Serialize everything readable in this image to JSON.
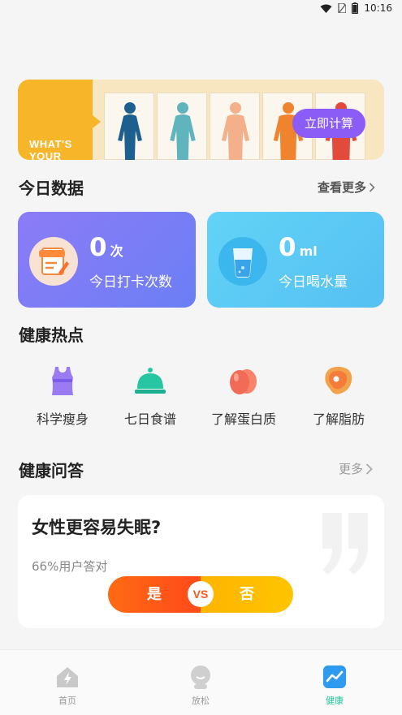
{
  "status_bar": {
    "time": "10:16",
    "icons": [
      "wifi-icon",
      "sim-icon",
      "battery-icon"
    ]
  },
  "banner": {
    "text_line1": "WHAT'S",
    "text_line2": "YOUR",
    "button_label": "立即计算",
    "figure_colors": [
      "#1d5f8f",
      "#5fb4bd",
      "#f3b08a",
      "#f0842e",
      "#e24b3c"
    ]
  },
  "today": {
    "title": "今日数据",
    "more_label": "查看更多",
    "checkin": {
      "value": "0",
      "unit": "次",
      "label": "今日打卡次数",
      "icon": "checklist-icon"
    },
    "water": {
      "value": "0",
      "unit": "ml",
      "label": "今日喝水量",
      "icon": "water-glass-icon"
    }
  },
  "hot": {
    "title": "健康热点",
    "items": [
      {
        "label": "科学瘦身",
        "icon": "tank-top-icon"
      },
      {
        "label": "七日食谱",
        "icon": "food-cloche-icon"
      },
      {
        "label": "了解蛋白质",
        "icon": "eggs-icon"
      },
      {
        "label": "了解脂肪",
        "icon": "meat-icon"
      }
    ]
  },
  "qa": {
    "title": "健康问答",
    "more_label": "更多",
    "question": "女性更容易失眠?",
    "stat": "66%用户答对",
    "yes_label": "是",
    "vs_label": "VS",
    "no_label": "否"
  },
  "nav": {
    "items": [
      {
        "label": "首页",
        "icon": "home-icon",
        "active": false
      },
      {
        "label": "放松",
        "icon": "relax-icon",
        "active": false
      },
      {
        "label": "健康",
        "icon": "health-chart-icon",
        "active": true
      }
    ]
  },
  "colors": {
    "accent_green": "#1fc39b",
    "banner_button": "#8b5cf6",
    "card_purple": "#7b7df5",
    "card_blue": "#5cc8f5"
  }
}
